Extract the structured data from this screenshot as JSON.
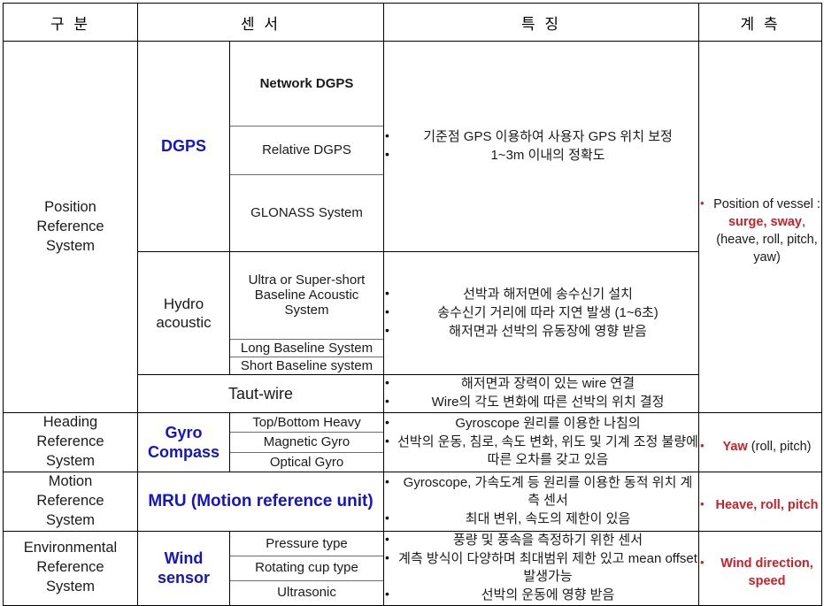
{
  "table": {
    "headers": [
      {
        "label": "구 분"
      },
      {
        "label": "센 서"
      },
      {
        "label": "특 징"
      },
      {
        "label": "계 측"
      }
    ],
    "rows": [
      {
        "category": "Position\nReference\nSystem",
        "groups": [
          {
            "name": "DGPS",
            "name_style": "blue",
            "items": [
              {
                "text": "Network DGPS",
                "style": "blue"
              },
              {
                "text": "Relative DGPS",
                "style": "plain"
              },
              {
                "text": "GLONASS System",
                "style": "plain"
              }
            ],
            "features": [
              "기준점 GPS 이용하여 사용자 GPS 위치 보정",
              "1~3m 이내의 정확도"
            ]
          },
          {
            "name": "Hydro\nacoustic",
            "name_style": "plain",
            "items": [
              {
                "text": "Ultra  or Super-short\nBaseline Acoustic System",
                "style": "small"
              },
              {
                "text": "Long  Baseline  System",
                "style": "small"
              },
              {
                "text": "Short  Baseline  system",
                "style": "small"
              }
            ],
            "features": [
              "선박과 해저면에 송수신기 설치",
              "송수신기 거리에 따라 지연 발생 (1~6초)",
              "해저면과 선박의 유동장에 영향 받음"
            ]
          },
          {
            "name": "Taut-wire",
            "name_style": "wide",
            "items": [],
            "features": [
              "해저면과 장력이 있는 wire 연결",
              "Wire의 각도 변화에 따른 선박의 위치 결정"
            ]
          }
        ],
        "measurement": {
          "bullets": [
            {
              "segments": [
                {
                  "text": "Position of vessel : ",
                  "style": "plain"
                },
                {
                  "text": "surge, sway",
                  "style": "red"
                },
                {
                  "text": ", (heave, roll, pitch, yaw)",
                  "style": "plain"
                }
              ]
            }
          ]
        }
      },
      {
        "category": "Heading\nReference\nSystem",
        "groups": [
          {
            "name": "Gyro\nCompass",
            "name_style": "blue",
            "items": [
              {
                "text": "Top/Bottom Heavy",
                "style": "plain"
              },
              {
                "text": "Magnetic Gyro",
                "style": "plain"
              },
              {
                "text": "Optical Gyro",
                "style": "plain"
              }
            ],
            "features": [
              "Gyroscope 원리를 이용한 나침의",
              "선박의 운동, 침로, 속도 변화, 위도 및 기계 조정 불량에 따른 오차를 갖고 있음"
            ]
          }
        ],
        "measurement": {
          "bullets": [
            {
              "segments": [
                {
                  "text": "Yaw",
                  "style": "red"
                },
                {
                  "text": " (roll, pitch)",
                  "style": "plain"
                }
              ]
            }
          ]
        }
      },
      {
        "category": "Motion\nReference\nSystem",
        "groups": [
          {
            "name": "MRU (Motion reference  unit)",
            "name_style": "wide-blue",
            "items": [],
            "features": [
              "Gyroscope, 가속도계 등 원리를 이용한 동적 위치 계측 센서",
              "최대 변위, 속도의 제한이 있음"
            ]
          }
        ],
        "measurement": {
          "bullets": [
            {
              "segments": [
                {
                  "text": "Heave, roll, pitch",
                  "style": "red"
                }
              ]
            }
          ]
        }
      },
      {
        "category": "Environmental\nReference\nSystem",
        "groups": [
          {
            "name": "Wind\nsensor",
            "name_style": "blue",
            "items": [
              {
                "text": "Pressure type",
                "style": "plain"
              },
              {
                "text": "Rotating cup type",
                "style": "plain"
              },
              {
                "text": "Ultrasonic",
                "style": "plain"
              }
            ],
            "features": [
              "풍량 및 풍속을 측정하기 위한 센서",
              "계측 방식이 다양하며 최대범위 제한 있고 mean offset 발생가능",
              "선박의 운동에 영향 받음"
            ]
          }
        ],
        "measurement": {
          "bullets": [
            {
              "segments": [
                {
                  "text": "Wind direction, speed",
                  "style": "red"
                }
              ]
            }
          ]
        }
      }
    ]
  },
  "colors": {
    "blue": "#1414c8",
    "red": "#cc2026",
    "border": "#000000",
    "sub_border": "#6e6e6e"
  }
}
